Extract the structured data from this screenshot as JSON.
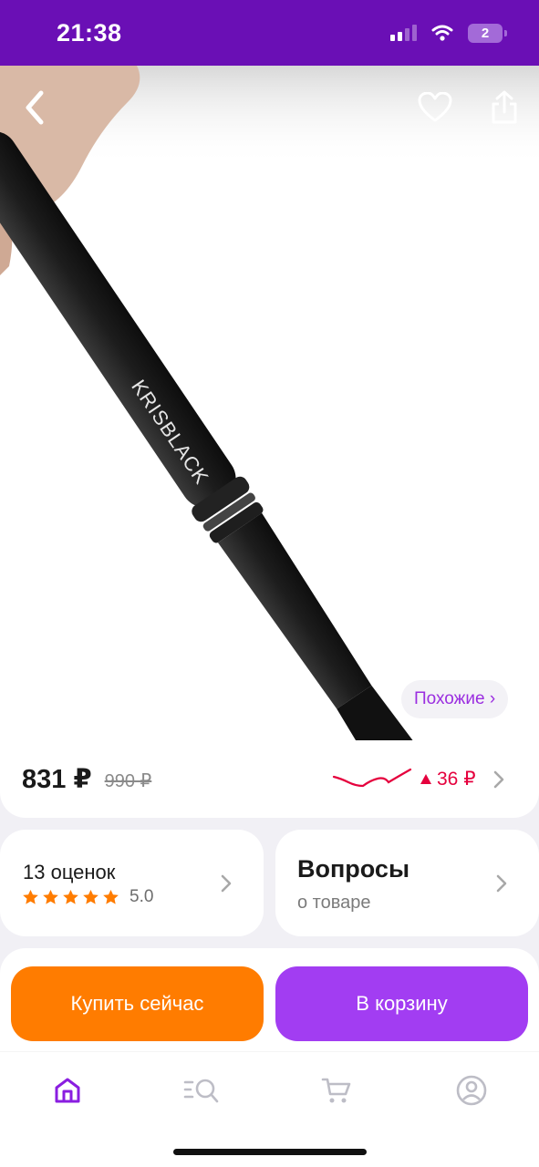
{
  "status_bar": {
    "time": "21:38",
    "battery": "2"
  },
  "product": {
    "brand_imprint": "KRISBLACK",
    "similar_label": "Похожие ›"
  },
  "price": {
    "current": "831 ₽",
    "old": "990 ₽",
    "change": "36 ₽"
  },
  "reviews": {
    "title": "13 оценок",
    "rating": "5.0",
    "stars": 5
  },
  "questions": {
    "title": "Вопросы",
    "subtitle": "о товаре"
  },
  "actions": {
    "buy_now": "Купить сейчас",
    "add_to_cart": "В корзину"
  },
  "colors": {
    "brand_purple": "#6a0fb5",
    "accent_purple": "#a23df2",
    "orange": "#ff7c00",
    "price_up_red": "#e5003d"
  },
  "tabs": [
    {
      "icon": "home-icon",
      "active": true
    },
    {
      "icon": "catalog-search-icon",
      "active": false
    },
    {
      "icon": "cart-icon",
      "active": false
    },
    {
      "icon": "profile-icon",
      "active": false
    }
  ]
}
